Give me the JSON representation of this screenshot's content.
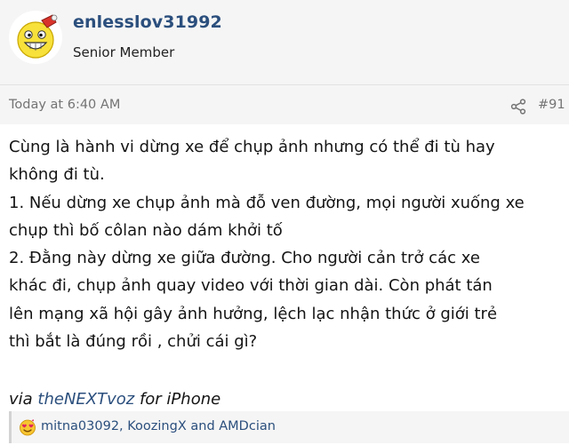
{
  "user": {
    "username": "enlesslov31992",
    "title": "Senior Member",
    "avatar_icon": "grinning-emoji-icon"
  },
  "meta": {
    "time": "Today at 6:40 AM",
    "share_icon": "share-icon",
    "post_number": "#91"
  },
  "body": {
    "lines": [
      "Cùng là hành vi dừng xe để chụp ảnh nhưng có thể đi tù hay",
      "không đi tù.",
      "1. Nếu dừng xe chụp ảnh mà đỗ ven đường, mọi người xuống xe",
      "chụp thì bố côlan nào dám khởi tố",
      "2. Đằng này dừng xe giữa đường. Cho người cản trở các xe",
      "khác đi, chụp ảnh quay video với thời gian dài. Còn phát tán",
      "lên mạng xã hội gây ảnh hưởng, lệch lạc nhận thức ở giới trẻ",
      "thì bắt là đúng rồi , chửi cái gì?"
    ],
    "signature": {
      "prefix": "via ",
      "link": "theNEXTvoz",
      "suffix": " for iPhone"
    }
  },
  "reactions": {
    "icon": "love-face-icon",
    "text": "mitna03092, KoozingX and AMDcian"
  },
  "colors": {
    "username": "#2b4f7d",
    "link": "#2b4f7d",
    "header_bg": "#f5f5f5",
    "meta_text": "#747474"
  }
}
